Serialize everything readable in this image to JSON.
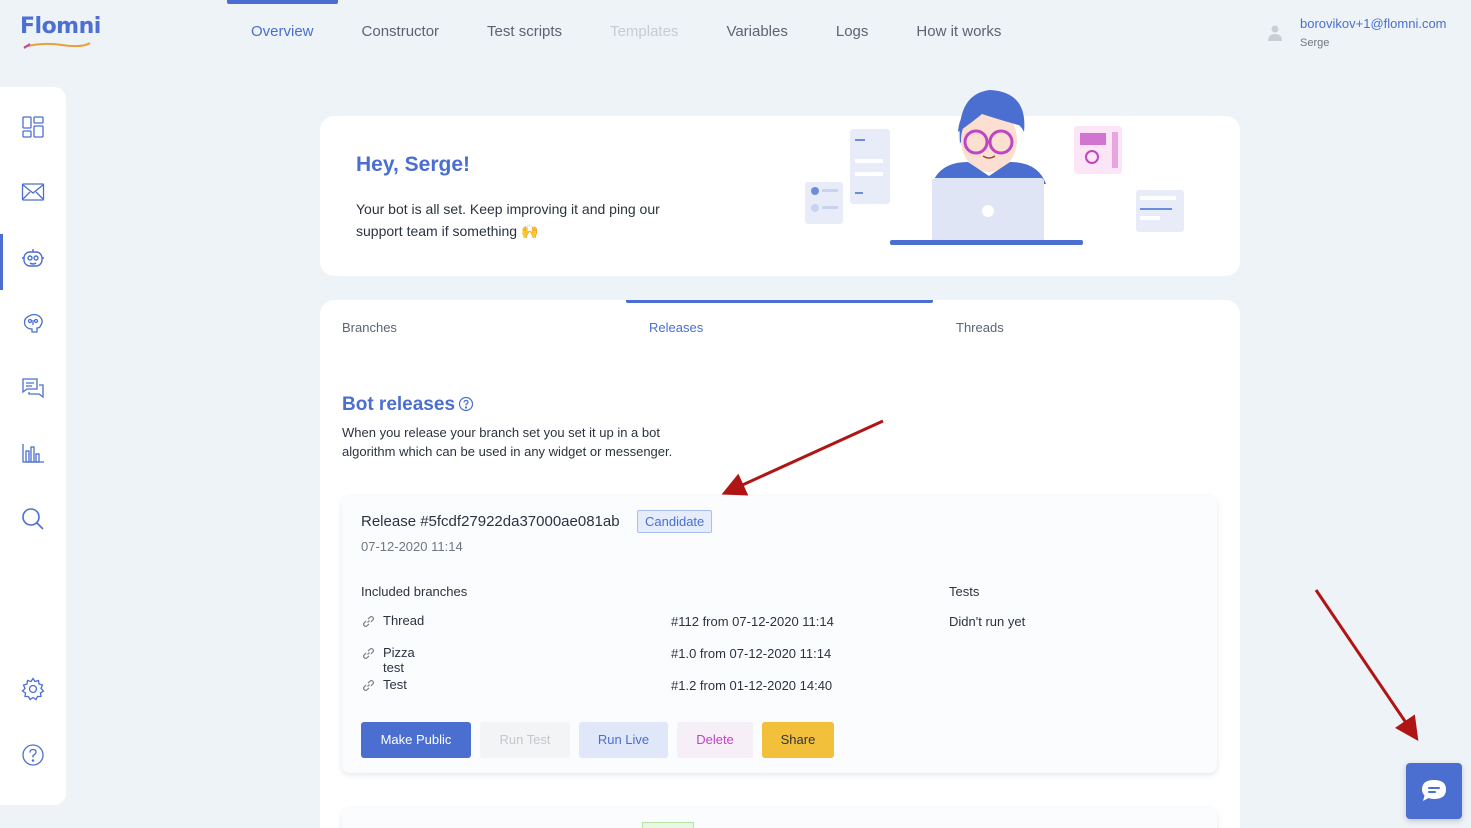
{
  "brand": {
    "name": "Flomni"
  },
  "topnav": {
    "items": [
      {
        "label": "Overview"
      },
      {
        "label": "Constructor"
      },
      {
        "label": "Test scripts"
      },
      {
        "label": "Templates"
      },
      {
        "label": "Variables"
      },
      {
        "label": "Logs"
      },
      {
        "label": "How it works"
      }
    ]
  },
  "user": {
    "email": "borovikov+1@flomni.com",
    "name": "Serge"
  },
  "sidebar": {
    "icons": [
      "dashboard-icon",
      "mail-icon",
      "bot-icon",
      "brain-icon",
      "chat-icon",
      "analytics-icon",
      "search-icon",
      "settings-icon",
      "help-icon"
    ]
  },
  "hero": {
    "title": "Hey, Serge!",
    "text": "Your bot is all set. Keep improving it and ping our support team if something 🙌"
  },
  "tabs": {
    "branches": "Branches",
    "releases": "Releases",
    "threads": "Threads"
  },
  "section": {
    "title": "Bot releases",
    "description": "When you release your branch set you set it up in a bot algorithm which can be used in any widget or messenger."
  },
  "release": {
    "title": "Release #5fcdf27922da37000ae081ab",
    "badge": "Candidate",
    "date": "07-12-2020 11:14",
    "branches_header": "Included branches",
    "tests_header": "Tests",
    "tests_value": "Didn't run yet",
    "branches": [
      {
        "name": "Thread",
        "version": "#112 from 07-12-2020 11:14"
      },
      {
        "name": "Pizza test",
        "version": "#1.0 from 07-12-2020 11:14"
      },
      {
        "name": "Test",
        "version": "#1.2 from 01-12-2020 14:40"
      }
    ],
    "buttons": {
      "make_public": "Make Public",
      "run_test": "Run Test",
      "run_live": "Run Live",
      "delete": "Delete",
      "share": "Share"
    }
  },
  "colors": {
    "accent": "#4a6fd0",
    "background": "#eef3f7",
    "share": "#f3c03b",
    "delete_text": "#c045c2",
    "annotation_arrow": "#b01515"
  }
}
